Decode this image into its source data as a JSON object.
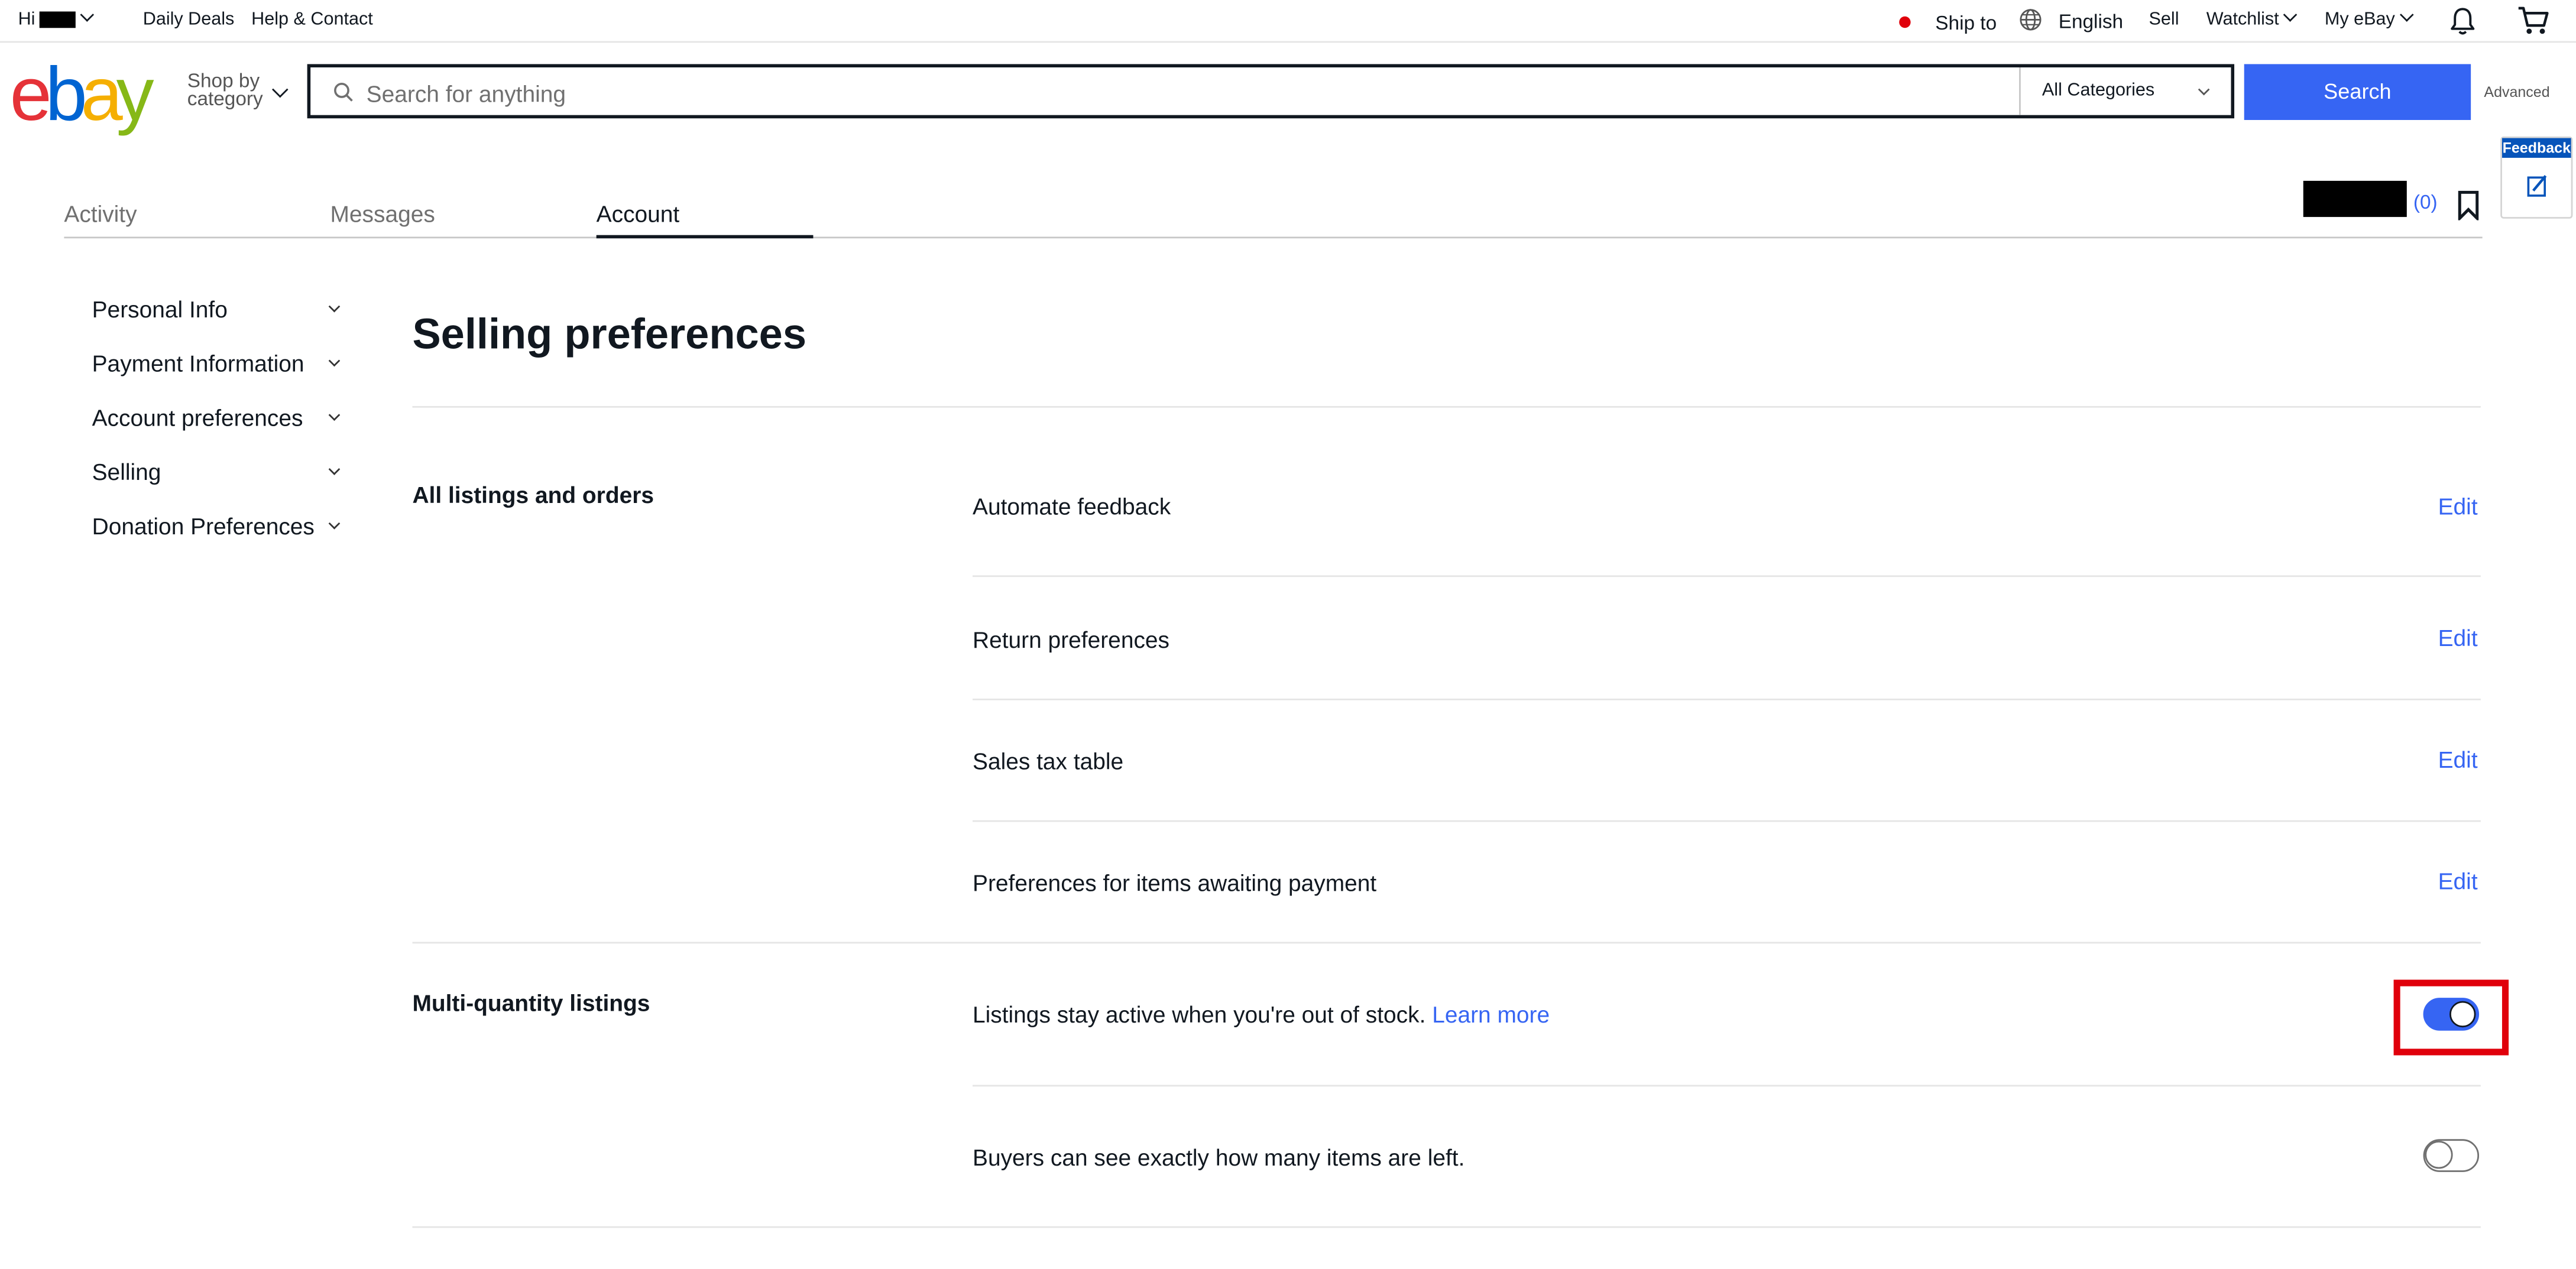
{
  "topbar": {
    "greeting": "Hi",
    "daily_deals": "Daily Deals",
    "help_contact": "Help & Contact",
    "ship_to": "Ship to",
    "language": "English",
    "sell": "Sell",
    "watchlist": "Watchlist",
    "my_ebay": "My eBay"
  },
  "header": {
    "logo": [
      "e",
      "b",
      "a",
      "y"
    ],
    "shop_by_line1": "Shop by",
    "shop_by_line2": "category",
    "search_placeholder": "Search for anything",
    "category_selected": "All Categories",
    "search_button": "Search",
    "advanced": "Advanced"
  },
  "feedback_tab": {
    "label": "Feedback"
  },
  "tabs": [
    {
      "label": "Activity"
    },
    {
      "label": "Messages"
    },
    {
      "label": "Account"
    }
  ],
  "user": {
    "count": "(0)"
  },
  "sidebar": {
    "items": [
      {
        "label": "Personal Info"
      },
      {
        "label": "Payment Information"
      },
      {
        "label": "Account preferences"
      },
      {
        "label": "Selling"
      },
      {
        "label": "Donation Preferences"
      }
    ]
  },
  "main": {
    "title": "Selling preferences",
    "sections": [
      {
        "title": "All listings and orders",
        "rows": [
          {
            "label": "Automate feedback",
            "action": "Edit"
          },
          {
            "label": "Return preferences",
            "action": "Edit"
          },
          {
            "label": "Sales tax table",
            "action": "Edit"
          },
          {
            "label": "Preferences for items awaiting payment",
            "action": "Edit"
          }
        ]
      },
      {
        "title": "Multi-quantity listings",
        "rows": [
          {
            "label": "Listings stay active when you're out of stock.",
            "link": "Learn more",
            "toggle": "on"
          },
          {
            "label": "Buyers can see exactly how many items are left.",
            "toggle": "off"
          }
        ]
      }
    ]
  },
  "colors": {
    "accent": "#3665f3",
    "highlight": "#e0000b",
    "ship_dot": "#e0000b"
  }
}
